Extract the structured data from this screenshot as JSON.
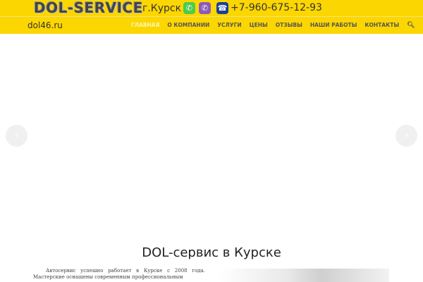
{
  "header": {
    "logo": "DOL-SERVICE",
    "city": "г.Курск",
    "phone": "+7-960-675-12-93",
    "icons": [
      "whatsapp-icon",
      "viber-icon",
      "phone-icon"
    ]
  },
  "nav": {
    "site": "dol46.ru",
    "items": [
      "ГЛАВНАЯ",
      "О КОМПАНИИ",
      "УСЛУГИ",
      "ЦЕНЫ",
      "ОТЗЫВЫ",
      "НАШИ РАБОТЫ",
      "КОНТАКТЫ"
    ],
    "active": "ГЛАВНАЯ"
  },
  "slider": {
    "prev": "‹",
    "next": "›"
  },
  "main": {
    "title": "DOL-сервис в Курске",
    "text": "Автосервис успешно работает в Курске с 2008 года. Мастерские оснащены современным профессиональным"
  },
  "colors": {
    "brand": "#fcd600"
  }
}
